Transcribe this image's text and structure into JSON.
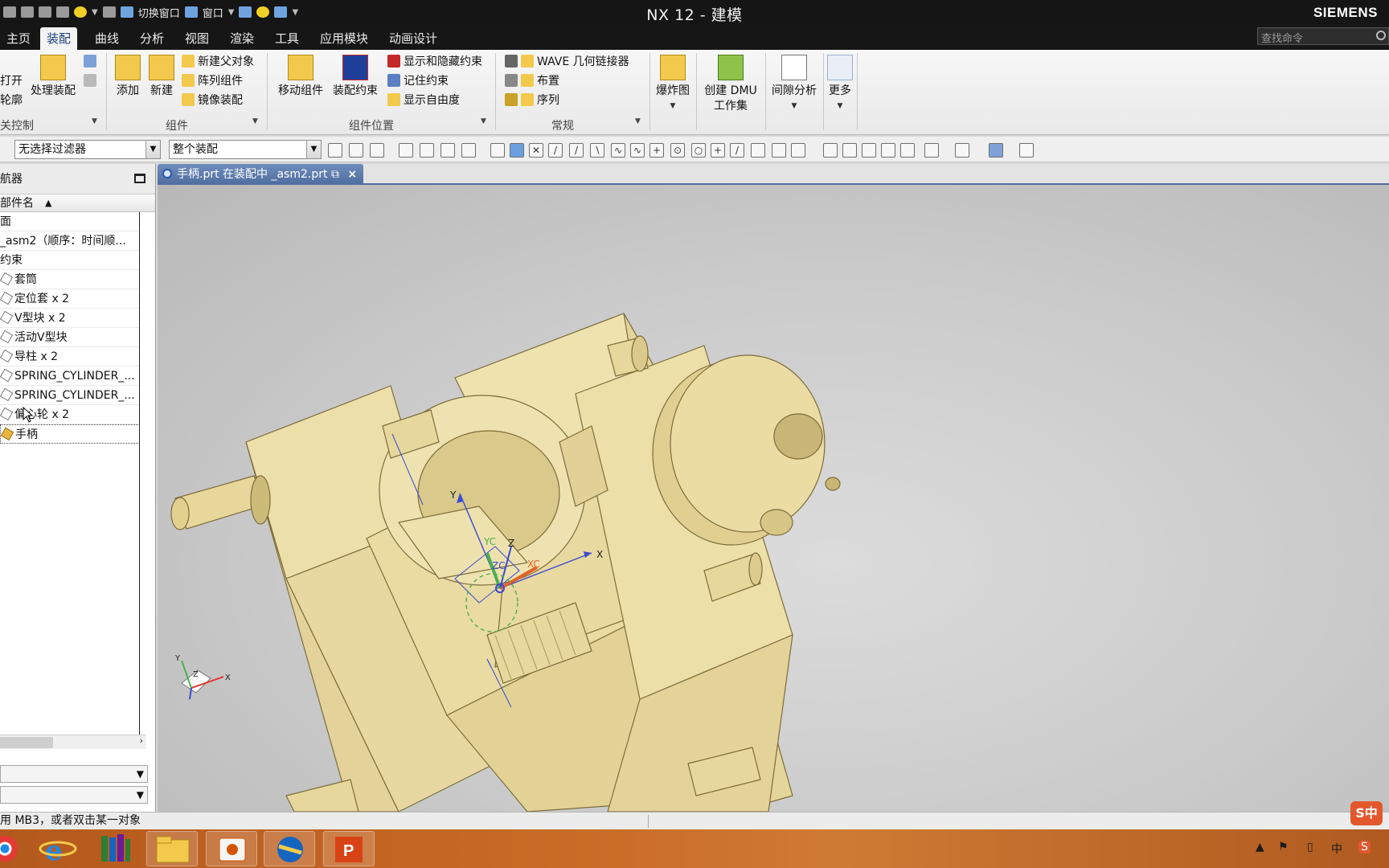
{
  "titlebar": {
    "title": "NX 12 - 建模",
    "brand": "SIEMENS",
    "quick_access": {
      "switch_window": "切换窗口",
      "window": "窗口"
    }
  },
  "menu": {
    "tabs": [
      "主页",
      "装配",
      "曲线",
      "分析",
      "视图",
      "渲染",
      "工具",
      "应用模块",
      "动画设计"
    ],
    "active": "装配",
    "search_placeholder": "查找命令"
  },
  "ribbon": {
    "left_partial": {
      "open": "打开",
      "outline": "轮廓",
      "group": "关控制"
    },
    "process_assembly": "处理装配",
    "add": "添加",
    "new": "新建",
    "new_parent": "新建父对象",
    "array_component": "阵列组件",
    "mirror_assembly": "镜像装配",
    "group_components": "组件",
    "move_component": "移动组件",
    "assembly_constraints": "装配约束",
    "show_hide_constraints": "显示和隐藏约束",
    "remember_constraints": "记住约束",
    "show_dof": "显示自由度",
    "group_position": "组件位置",
    "wave_linker": "WAVE 几何链接器",
    "arrangement": "布置",
    "sequence": "序列",
    "group_general": "常规",
    "exploded_view": "爆炸图",
    "create_dmu": "创建 DMU",
    "create_dmu_line2": "工作集",
    "clearance_analysis": "间隙分析",
    "more": "更多"
  },
  "toolbar": {
    "filter_value": "无选择过滤器",
    "scope_value": "整个装配"
  },
  "navigator": {
    "title": "航器",
    "column": "部件名",
    "rows": [
      {
        "label": "面",
        "icon": "none"
      },
      {
        "label": "_asm2（顺序：时间顺...",
        "icon": "none"
      },
      {
        "label": "约束",
        "icon": "none"
      },
      {
        "label": "套筒",
        "icon": "part"
      },
      {
        "label": "定位套 x 2",
        "icon": "part"
      },
      {
        "label": "V型块 x 2",
        "icon": "part"
      },
      {
        "label": "活动V型块",
        "icon": "part"
      },
      {
        "label": "导柱 x 2",
        "icon": "part"
      },
      {
        "label": "SPRING_CYLINDER_...",
        "icon": "part"
      },
      {
        "label": "SPRING_CYLINDER_...",
        "icon": "part"
      },
      {
        "label": "偏心轮 x 2",
        "icon": "part"
      },
      {
        "label": "手柄",
        "icon": "work-part"
      }
    ]
  },
  "document_tab": {
    "label": "手柄.prt 在装配中 _asm2.prt",
    "close": "×"
  },
  "viewport": {
    "csys_labels": {
      "x": "X",
      "y": "Y",
      "xc": "XC",
      "yc": "YC",
      "zc": "ZC",
      "z": "Z"
    },
    "triad_labels": {
      "x": "X",
      "y": "Y",
      "z": "Z"
    },
    "part_color": "#e9dba1"
  },
  "statusbar": {
    "prompt": "用 MB3，或者双击某一对象"
  },
  "taskbar": {
    "apps": [
      "chrome-icon",
      "ie-icon",
      "books-icon",
      "explorer-icon",
      "screen-recorder-icon",
      "nx-icon",
      "powerpoint-icon"
    ],
    "tray_ime": "中",
    "tray_ime_badge": "S中"
  },
  "colors": {
    "active_tab": "#1e3f7a",
    "doc_tab": "#5b79a8",
    "taskbar": "#c96a25"
  }
}
